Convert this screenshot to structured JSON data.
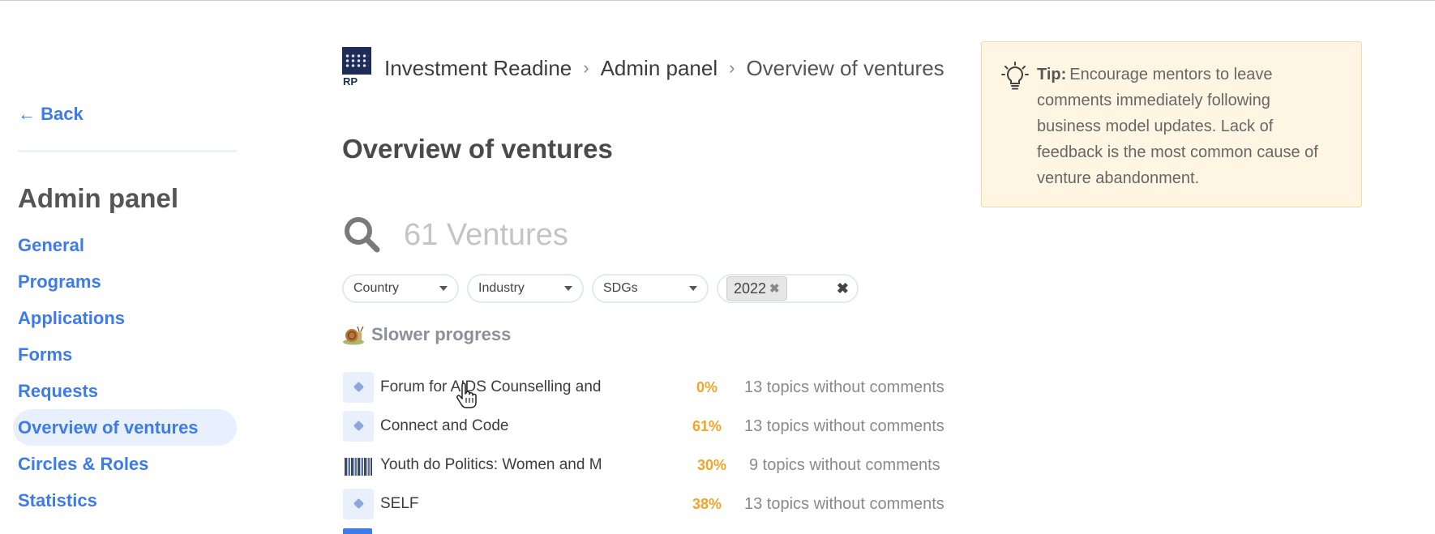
{
  "sidebar": {
    "back_label": "← Back",
    "heading": "Admin panel",
    "items": [
      {
        "label": "General"
      },
      {
        "label": "Programs"
      },
      {
        "label": "Applications"
      },
      {
        "label": "Forms"
      },
      {
        "label": "Requests"
      },
      {
        "label": "Overview of ventures",
        "active": true
      },
      {
        "label": "Circles & Roles"
      },
      {
        "label": "Statistics"
      }
    ]
  },
  "breadcrumb": {
    "logo_text": "RP",
    "items": [
      "Investment Readine",
      "Admin panel",
      "Overview of ventures"
    ]
  },
  "page": {
    "title": "Overview of ventures"
  },
  "tip": {
    "label": "Tip:",
    "text": "Encourage mentors to leave comments immediately following business model updates. Lack of feedback is the most common cause of venture abandonment.",
    "icon": "lightbulb-icon"
  },
  "search": {
    "placeholder": "61 Ventures",
    "value": "",
    "icon": "search-icon"
  },
  "filters": {
    "country": "Country",
    "industry": "Industry",
    "sdgs": "SDGs",
    "year_tag": "2022"
  },
  "section": {
    "title": "Slower progress",
    "icon": "snail-icon"
  },
  "ventures": [
    {
      "name": "Forum for AIDS Counselling and",
      "progress": "0%",
      "comments": "13 topics without comments",
      "thumb": "cube-icon"
    },
    {
      "name": "Connect and Code",
      "progress": "61%",
      "comments": "13 topics without comments",
      "thumb": "cube-icon"
    },
    {
      "name": "Youth do Politics: Women and M",
      "progress": "30%",
      "comments": "9 topics without comments",
      "thumb": "photo"
    },
    {
      "name": "SELF",
      "progress": "38%",
      "comments": "13 topics without comments",
      "thumb": "cube-icon"
    }
  ],
  "colors": {
    "accent": "#3d7be8",
    "progress": "#f0a52a",
    "tip_background": "#fff5e3"
  }
}
